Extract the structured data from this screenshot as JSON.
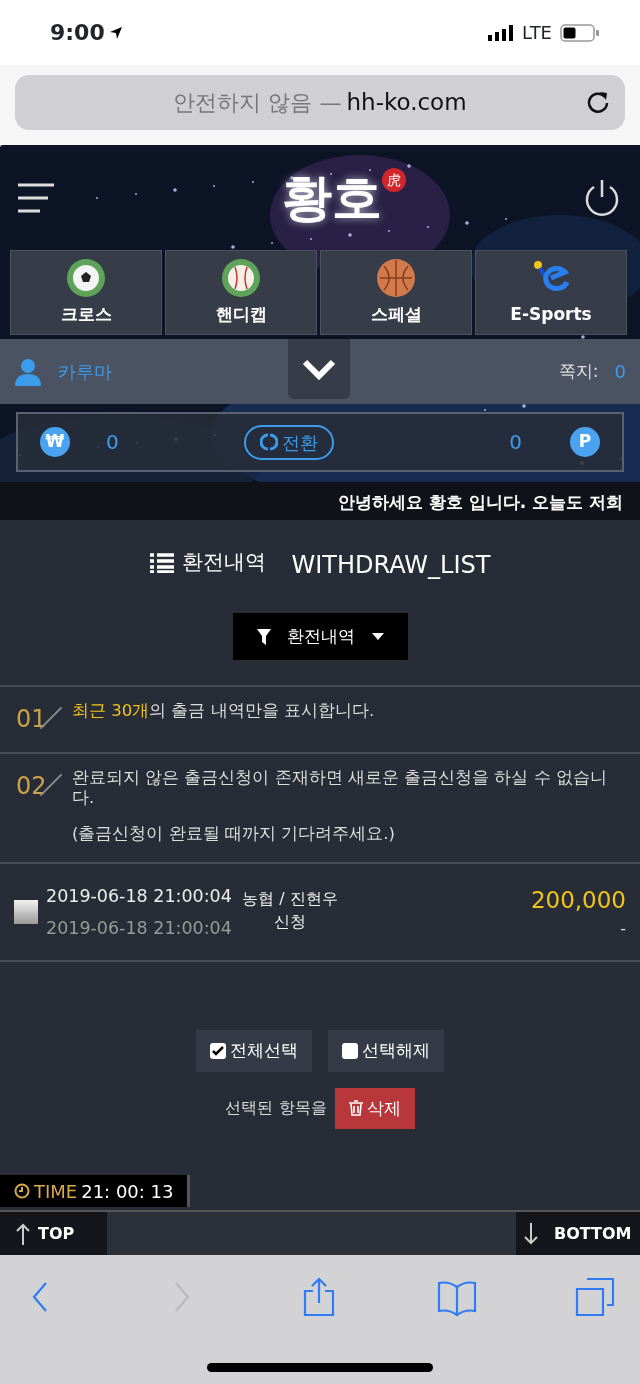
{
  "status_bar": {
    "time": "9:00",
    "network": "LTE"
  },
  "browser": {
    "security": "안전하지 않음 —",
    "domain": "hh-ko.com"
  },
  "header": {
    "logo": "황호",
    "seal": "虎"
  },
  "sports_tabs": [
    {
      "label": "크로스",
      "kind": "soccer"
    },
    {
      "label": "핸디캡",
      "kind": "baseball"
    },
    {
      "label": "스페셜",
      "kind": "basketball"
    },
    {
      "label": "E-Sports",
      "kind": "esports"
    }
  ],
  "user": {
    "name": "카루마",
    "messages_label": "쪽지:",
    "messages_count": "0"
  },
  "wallet": {
    "cash_symbol": "₩",
    "cash": "0",
    "convert": "전환",
    "points": "0",
    "points_symbol": "P"
  },
  "ticker": "안녕하세요 황호 입니다. 오늘도 저희",
  "page_title": {
    "title": "환전내역",
    "subtitle": "WITHDRAW_LIST"
  },
  "filter": {
    "label": "환전내역"
  },
  "notes": [
    {
      "number": "01",
      "text": "**최근 30개**의 출금 내역만을 표시합니다."
    },
    {
      "number": "02",
      "text": "완료되지 않은 출금신청이 존재하면 새로운 출금신청을 하실 수 없습니다.",
      "subtext": "(출금신청이 완료될 때까지 기다려주세요.)"
    }
  ],
  "rows": [
    {
      "checked": false,
      "requested": "2019-06-18 21:00:04",
      "processed": "2019-06-18 21:00:04",
      "bank": "농협 / 진현우",
      "status": "신청",
      "amount": "200,000",
      "amount_2": "-"
    }
  ],
  "actions": {
    "select_all": {
      "label": "전체선택",
      "checked": true
    },
    "deselect": {
      "label": "선택해제",
      "checked": false
    },
    "delete_label": "선택된 항목을",
    "delete": "삭제"
  },
  "clock": {
    "label": "TIME",
    "value": "21: 00: 13"
  },
  "scroll": {
    "top": "TOP",
    "bottom": "BOTTOM"
  },
  "toolbar": [
    {
      "kind": "back",
      "disabled": false
    },
    {
      "kind": "forward",
      "disabled": true
    },
    {
      "kind": "share",
      "disabled": false
    },
    {
      "kind": "bookmarks",
      "disabled": false
    },
    {
      "kind": "tabs",
      "disabled": false
    }
  ]
}
